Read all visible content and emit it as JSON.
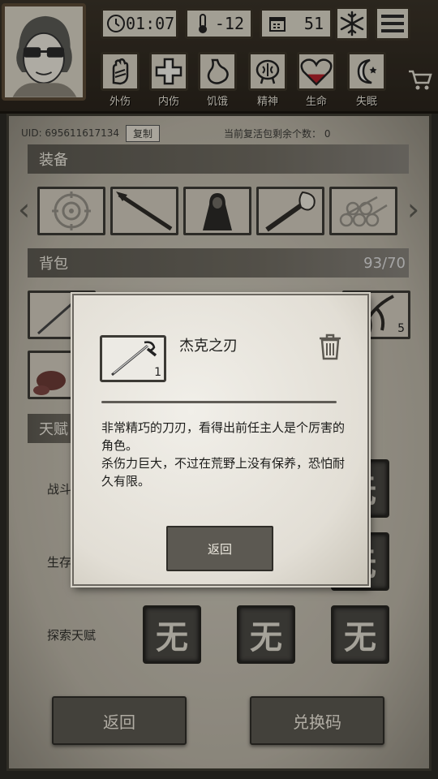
{
  "hud": {
    "time": "01:07",
    "temperature": "-12",
    "day": "51",
    "status_items": [
      {
        "label": "外伤"
      },
      {
        "label": "内伤"
      },
      {
        "label": "饥饿"
      },
      {
        "label": "精神"
      },
      {
        "label": "生命"
      },
      {
        "label": "失眠"
      }
    ],
    "health_fill": 0.4
  },
  "account": {
    "uid": "UID: 695611617134",
    "copy_label": "复制",
    "revive_text": "当前复活包剩余个数： 0"
  },
  "equipment": {
    "title": "装备",
    "slots": [
      "target-slot",
      "spear-slot",
      "coat-slot",
      "torch-slot",
      "logs-slot"
    ]
  },
  "backpack": {
    "title": "背包",
    "count": "93/70",
    "visible_count_badge": "5"
  },
  "talents": {
    "title": "天赋",
    "rows": [
      {
        "label": "战斗天赋",
        "value": "无"
      },
      {
        "label": "生存天赋",
        "value": "无"
      },
      {
        "label": "探索天赋",
        "value": "无"
      }
    ],
    "visible_label_1": "战斗",
    "visible_label_2": "生存",
    "visible_title": "天赋",
    "wu": "无"
  },
  "footer": {
    "back_label": "返回",
    "redeem_label": "兑换码"
  },
  "dialog": {
    "item_name": "杰克之刃",
    "quantity": "1",
    "description_line1": "非常精巧的刀刃，看得出前任主人是个厉害的角色。",
    "description_line2": "杀伤力巨大，不过在荒野上没有保养，恐怕耐久有限。",
    "back_label": "返回"
  },
  "colors": {
    "panel": "#c6c0b2",
    "section_bar": "#5b5850",
    "health_red": "#b0202a"
  }
}
